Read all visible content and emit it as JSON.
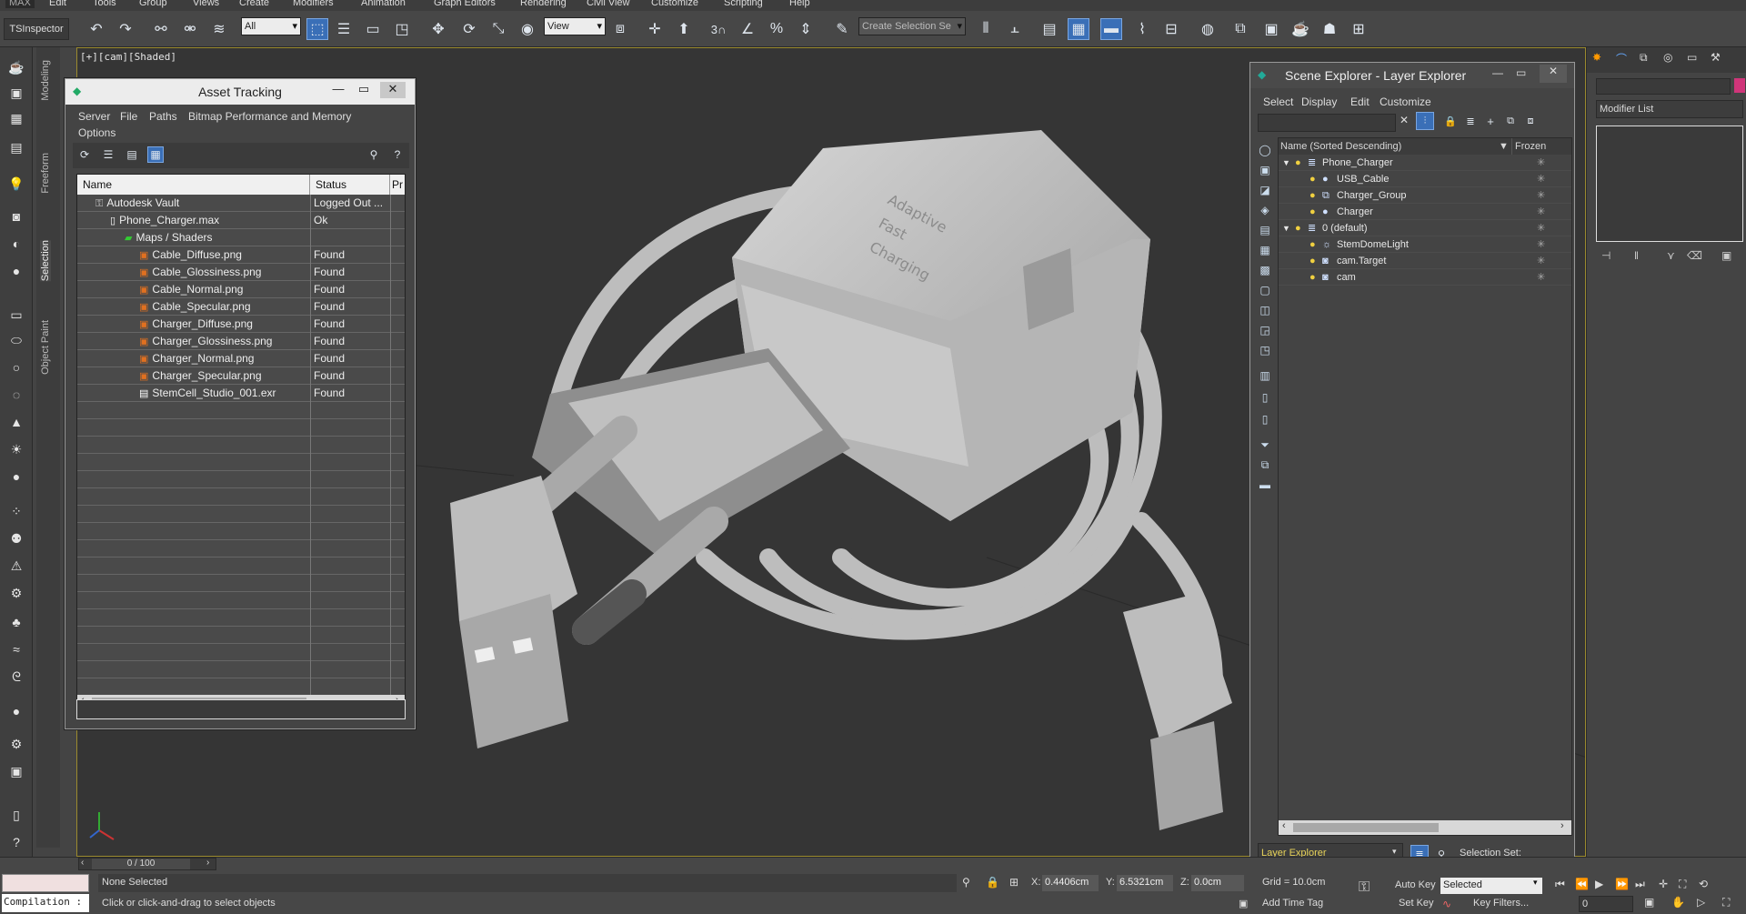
{
  "menubar": {
    "items": [
      "Edit",
      "Tools",
      "Group",
      "Views",
      "Create",
      "Modifiers",
      "Animation",
      "Graph Editors",
      "Rendering",
      "Civil View",
      "Customize",
      "Scripting",
      "Help"
    ]
  },
  "toolbar": {
    "tsinspector_label": "TSInspector",
    "filter_select": "All",
    "refcoord_select": "View",
    "selection_set_placeholder": "Create Selection Se",
    "snap_label": "3"
  },
  "left_tabs": [
    "Modeling",
    "Freeform",
    "Selection",
    "Object Paint"
  ],
  "viewport": {
    "label": "[+][cam][Shaded]"
  },
  "asset_tracking": {
    "title": "Asset Tracking",
    "menu": [
      "Server",
      "File",
      "Paths",
      "Bitmap Performance and Memory",
      "Options"
    ],
    "columns": [
      "Name",
      "Status",
      "Pr"
    ],
    "rows": [
      {
        "name": "Autodesk Vault",
        "status": "Logged Out ...",
        "indent": 0,
        "icon": "vault"
      },
      {
        "name": "Phone_Charger.max",
        "status": "Ok",
        "indent": 1,
        "icon": "file"
      },
      {
        "name": "Maps / Shaders",
        "status": "",
        "indent": 2,
        "icon": "folder"
      },
      {
        "name": "Cable_Diffuse.png",
        "status": "Found",
        "indent": 3,
        "icon": "image"
      },
      {
        "name": "Cable_Glossiness.png",
        "status": "Found",
        "indent": 3,
        "icon": "image"
      },
      {
        "name": "Cable_Normal.png",
        "status": "Found",
        "indent": 3,
        "icon": "image"
      },
      {
        "name": "Cable_Specular.png",
        "status": "Found",
        "indent": 3,
        "icon": "image"
      },
      {
        "name": "Charger_Diffuse.png",
        "status": "Found",
        "indent": 3,
        "icon": "image"
      },
      {
        "name": "Charger_Glossiness.png",
        "status": "Found",
        "indent": 3,
        "icon": "image"
      },
      {
        "name": "Charger_Normal.png",
        "status": "Found",
        "indent": 3,
        "icon": "image"
      },
      {
        "name": "Charger_Specular.png",
        "status": "Found",
        "indent": 3,
        "icon": "image"
      },
      {
        "name": "StemCell_Studio_001.exr",
        "status": "Found",
        "indent": 3,
        "icon": "doc"
      }
    ]
  },
  "scene_explorer": {
    "title": "Scene Explorer - Layer Explorer",
    "menu": [
      "Select",
      "Display",
      "Edit",
      "Customize"
    ],
    "columns": [
      "Name (Sorted Descending)",
      "Frozen"
    ],
    "rows": [
      {
        "name": "Phone_Charger",
        "indent": 0,
        "expanded": true,
        "icon": "layer"
      },
      {
        "name": "USB_Cable",
        "indent": 1,
        "icon": "object"
      },
      {
        "name": "Charger_Group",
        "indent": 1,
        "icon": "group"
      },
      {
        "name": "Charger",
        "indent": 1,
        "icon": "object"
      },
      {
        "name": "0 (default)",
        "indent": 0,
        "expanded": true,
        "icon": "layer"
      },
      {
        "name": "StemDomeLight",
        "indent": 1,
        "icon": "light"
      },
      {
        "name": "cam.Target",
        "indent": 1,
        "icon": "camera"
      },
      {
        "name": "cam",
        "indent": 1,
        "icon": "camera"
      }
    ],
    "footer_select": "Layer Explorer",
    "selection_set_label": "Selection Set:"
  },
  "right_panel": {
    "modifier_list": "Modifier List"
  },
  "timeline": {
    "frame_counter": "0 / 100"
  },
  "status": {
    "maxscript_label": "Compilation :",
    "selection_status": "None Selected",
    "prompt": "Click or click-and-drag to select objects",
    "x_label": "X:",
    "x_value": "0.4406cm",
    "y_label": "Y:",
    "y_value": "6.5321cm",
    "z_label": "Z:",
    "z_value": "0.0cm",
    "grid": "Grid = 10.0cm",
    "add_time_tag": "Add Time Tag",
    "auto_key": "Auto Key",
    "set_key": "Set Key",
    "key_mode_select": "Selected",
    "key_filters": "Key Filters...",
    "current_frame": "0"
  },
  "colors": {
    "accent_blue": "#3a6fb7",
    "viewport_border": "#9b8a2e",
    "layer_explorer_text": "#e8d35a"
  }
}
